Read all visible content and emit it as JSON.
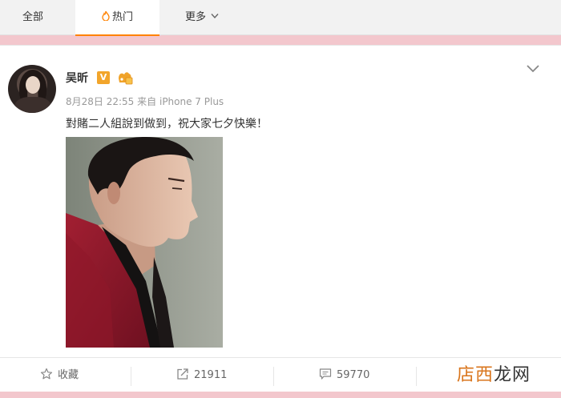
{
  "tabs": {
    "all_label": "全部",
    "hot_label": "热门",
    "more_label": "更多"
  },
  "post": {
    "author": "吴昕",
    "verified_badge": "V",
    "timestamp": "8月28日 22:55",
    "source_prefix": "来自",
    "source": "iPhone 7 Plus",
    "text": "對賭二人組說到做到，祝大家七夕快樂！"
  },
  "actions": {
    "favorite_label": "收藏",
    "share_count": "21911",
    "comment_count": "59770"
  },
  "watermark": {
    "part1": "店西",
    "part2": "龙网"
  },
  "colors": {
    "accent": "#ff8200",
    "verified": "#f2a52b",
    "background": "#f3c7cd"
  },
  "icons": [
    "flame-icon",
    "chevron-down-icon",
    "star-icon",
    "share-icon",
    "comment-icon"
  ]
}
